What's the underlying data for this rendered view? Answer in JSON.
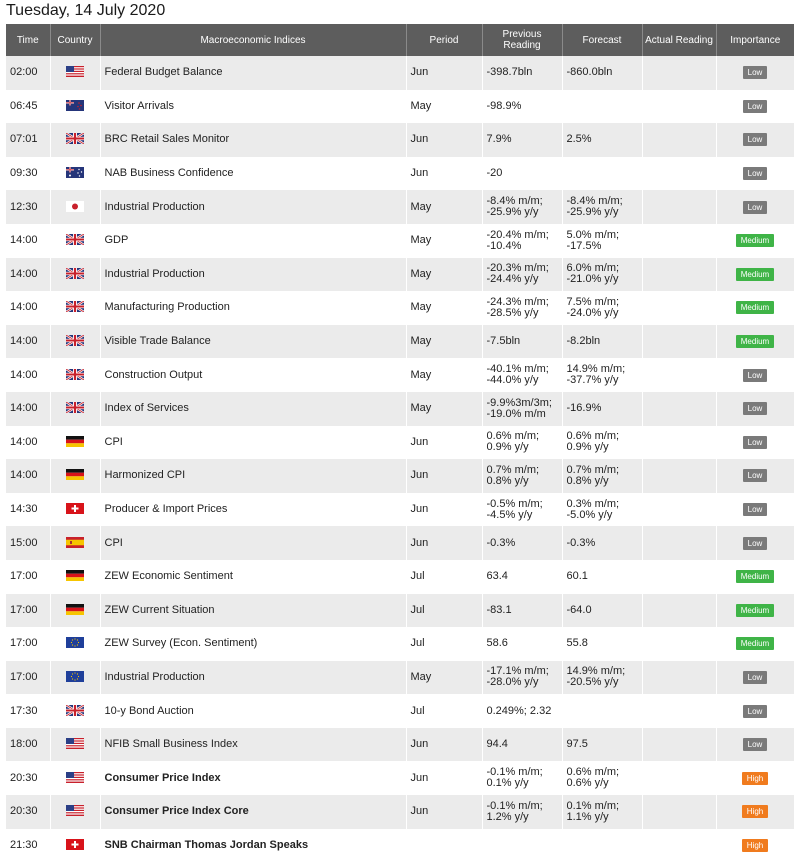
{
  "title": "Tuesday, 14 July 2020",
  "headers": {
    "time": "Time",
    "country": "Country",
    "indices": "Macroeconomic Indices",
    "period": "Period",
    "previous": "Previous Reading",
    "forecast": "Forecast",
    "actual": "Actual Reading",
    "importance": "Importance"
  },
  "rows": [
    {
      "time": "02:00",
      "country": "us-flag-icon",
      "indicator": "Federal Budget Balance",
      "bold": false,
      "period": "Jun",
      "prev": [
        "-398.7bln"
      ],
      "forecast": [
        "-860.0bln"
      ],
      "actual": "",
      "importance": "Low"
    },
    {
      "time": "06:45",
      "country": "nz-flag-icon",
      "indicator": "Visitor Arrivals",
      "bold": false,
      "period": "May",
      "prev": [
        "-98.9%"
      ],
      "forecast": [],
      "actual": "",
      "importance": "Low"
    },
    {
      "time": "07:01",
      "country": "uk-flag-icon",
      "indicator": "BRC Retail Sales Monitor",
      "bold": false,
      "period": "Jun",
      "prev": [
        "7.9%"
      ],
      "forecast": [
        "2.5%"
      ],
      "actual": "",
      "importance": "Low"
    },
    {
      "time": "09:30",
      "country": "au-flag-icon",
      "indicator": "NAB Business Confidence",
      "bold": false,
      "period": "Jun",
      "prev": [
        "-20"
      ],
      "forecast": [],
      "actual": "",
      "importance": "Low"
    },
    {
      "time": "12:30",
      "country": "jp-flag-icon",
      "indicator": "Industrial Production",
      "bold": false,
      "period": "May",
      "prev": [
        "-8.4% m/m;",
        "-25.9% y/y"
      ],
      "forecast": [
        "-8.4% m/m;",
        "-25.9% y/y"
      ],
      "actual": "",
      "importance": "Low"
    },
    {
      "time": "14:00",
      "country": "uk-flag-icon",
      "indicator": "GDP",
      "bold": false,
      "period": "May",
      "prev": [
        "-20.4% m/m;",
        "-10.4%"
      ],
      "forecast": [
        "5.0% m/m;",
        "-17.5%"
      ],
      "actual": "",
      "importance": "Medium"
    },
    {
      "time": "14:00",
      "country": "uk-flag-icon",
      "indicator": "Industrial Production",
      "bold": false,
      "period": "May",
      "prev": [
        "-20.3% m/m;",
        "-24.4% y/y"
      ],
      "forecast": [
        "6.0% m/m;",
        "-21.0% y/y"
      ],
      "actual": "",
      "importance": "Medium"
    },
    {
      "time": "14:00",
      "country": "uk-flag-icon",
      "indicator": "Manufacturing Production",
      "bold": false,
      "period": "May",
      "prev": [
        "-24.3% m/m;",
        "-28.5% y/y"
      ],
      "forecast": [
        "7.5% m/m;",
        "-24.0% y/y"
      ],
      "actual": "",
      "importance": "Medium"
    },
    {
      "time": "14:00",
      "country": "uk-flag-icon",
      "indicator": "Visible Trade Balance",
      "bold": false,
      "period": "May",
      "prev": [
        "-7.5bln"
      ],
      "forecast": [
        "-8.2bln"
      ],
      "actual": "",
      "importance": "Medium"
    },
    {
      "time": "14:00",
      "country": "uk-flag-icon",
      "indicator": "Construction Output",
      "bold": false,
      "period": "May",
      "prev": [
        "-40.1% m/m;",
        "-44.0% y/y"
      ],
      "forecast": [
        "14.9% m/m;",
        "-37.7% y/y"
      ],
      "actual": "",
      "importance": "Low"
    },
    {
      "time": "14:00",
      "country": "uk-flag-icon",
      "indicator": "Index of Services",
      "bold": false,
      "period": "May",
      "prev": [
        "-9.9%3m/3m;",
        "-19.0% m/m"
      ],
      "forecast": [
        "-16.9%"
      ],
      "actual": "",
      "importance": "Low"
    },
    {
      "time": "14:00",
      "country": "de-flag-icon",
      "indicator": "CPI",
      "bold": false,
      "period": "Jun",
      "prev": [
        "0.6% m/m;",
        "0.9% y/y"
      ],
      "forecast": [
        "0.6% m/m;",
        "0.9% y/y"
      ],
      "actual": "",
      "importance": "Low"
    },
    {
      "time": "14:00",
      "country": "de-flag-icon",
      "indicator": "Harmonized CPI",
      "bold": false,
      "period": "Jun",
      "prev": [
        "0.7% m/m;",
        "0.8% y/y"
      ],
      "forecast": [
        "0.7% m/m;",
        "0.8% y/y"
      ],
      "actual": "",
      "importance": "Low"
    },
    {
      "time": "14:30",
      "country": "ch-flag-icon",
      "indicator": "Producer & Import Prices",
      "bold": false,
      "period": "Jun",
      "prev": [
        "-0.5% m/m;",
        "-4.5% y/y"
      ],
      "forecast": [
        "0.3% m/m;",
        "-5.0% y/y"
      ],
      "actual": "",
      "importance": "Low"
    },
    {
      "time": "15:00",
      "country": "es-flag-icon",
      "indicator": "CPI",
      "bold": false,
      "period": "Jun",
      "prev": [
        "-0.3%"
      ],
      "forecast": [
        "-0.3%"
      ],
      "actual": "",
      "importance": "Low"
    },
    {
      "time": "17:00",
      "country": "de-flag-icon",
      "indicator": "ZEW Economic Sentiment",
      "bold": false,
      "period": "Jul",
      "prev": [
        "63.4"
      ],
      "forecast": [
        "60.1"
      ],
      "actual": "",
      "importance": "Medium"
    },
    {
      "time": "17:00",
      "country": "de-flag-icon",
      "indicator": "ZEW Current Situation",
      "bold": false,
      "period": "Jul",
      "prev": [
        "-83.1"
      ],
      "forecast": [
        "-64.0"
      ],
      "actual": "",
      "importance": "Medium"
    },
    {
      "time": "17:00",
      "country": "eu-flag-icon",
      "indicator": "ZEW Survey (Econ. Sentiment)",
      "bold": false,
      "period": "Jul",
      "prev": [
        "58.6"
      ],
      "forecast": [
        "55.8"
      ],
      "actual": "",
      "importance": "Medium"
    },
    {
      "time": "17:00",
      "country": "eu-flag-icon",
      "indicator": "Industrial Production",
      "bold": false,
      "period": "May",
      "prev": [
        "-17.1% m/m;",
        "-28.0% y/y"
      ],
      "forecast": [
        "14.9% m/m;",
        "-20.5% y/y"
      ],
      "actual": "",
      "importance": "Low"
    },
    {
      "time": "17:30",
      "country": "uk-flag-icon",
      "indicator": "10-y Bond Auction",
      "bold": false,
      "period": "Jul",
      "prev": [
        "0.249%; 2.32"
      ],
      "forecast": [],
      "actual": "",
      "importance": "Low"
    },
    {
      "time": "18:00",
      "country": "us-flag-icon",
      "indicator": "NFIB Small Business Index",
      "bold": false,
      "period": "Jun",
      "prev": [
        "94.4"
      ],
      "forecast": [
        "97.5"
      ],
      "actual": "",
      "importance": "Low"
    },
    {
      "time": "20:30",
      "country": "us-flag-icon",
      "indicator": "Consumer Price Index",
      "bold": true,
      "period": "Jun",
      "prev": [
        "-0.1% m/m;",
        "0.1% y/y"
      ],
      "forecast": [
        "0.6% m/m;",
        "0.6% y/y"
      ],
      "actual": "",
      "importance": "High"
    },
    {
      "time": "20:30",
      "country": "us-flag-icon",
      "indicator": "Consumer Price Index Core",
      "bold": true,
      "period": "Jun",
      "prev": [
        "-0.1% m/m;",
        "1.2% y/y"
      ],
      "forecast": [
        "0.1% m/m;",
        "1.1% y/y"
      ],
      "actual": "",
      "importance": "High"
    },
    {
      "time": "21:30",
      "country": "ch-flag-icon",
      "indicator": "SNB Chairman Thomas Jordan Speaks",
      "bold": true,
      "period": "",
      "prev": [],
      "forecast": [],
      "actual": "",
      "importance": "High"
    }
  ],
  "colors": {
    "header_bg": "#5d5d5d",
    "row_alt": "#ebebeb",
    "low": "#7a7a7a",
    "medium": "#3fb447",
    "high": "#f07b1e"
  }
}
